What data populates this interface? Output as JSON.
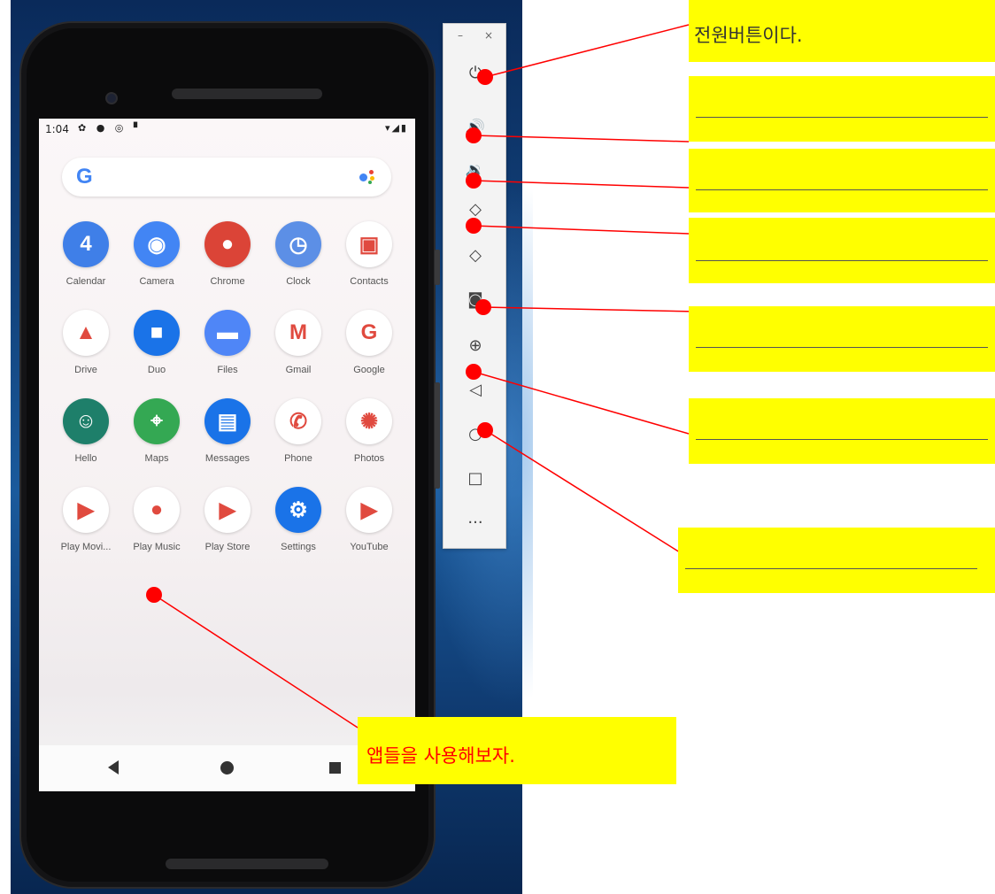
{
  "status_bar": {
    "time": "1:04",
    "left_icons": "✿ ● ◎ ▘",
    "right_icons": "▾◢▮"
  },
  "search": {
    "logo": "G"
  },
  "apps": [
    {
      "label": "Calendar",
      "glyph": "4",
      "bg": "#3f7fe8",
      "name": "calendar-app"
    },
    {
      "label": "Camera",
      "glyph": "◉",
      "bg": "#4285f4",
      "name": "camera-app"
    },
    {
      "label": "Chrome",
      "glyph": "●",
      "bg": "#db4437",
      "name": "chrome-app"
    },
    {
      "label": "Clock",
      "glyph": "◷",
      "bg": "#5c8fe6",
      "name": "clock-app"
    },
    {
      "label": "Contacts",
      "glyph": "▣",
      "bg": "#ffffff",
      "name": "contacts-app"
    },
    {
      "label": "Drive",
      "glyph": "▲",
      "bg": "#ffffff",
      "name": "drive-app"
    },
    {
      "label": "Duo",
      "glyph": "■",
      "bg": "#1a73e8",
      "name": "duo-app"
    },
    {
      "label": "Files",
      "glyph": "▬",
      "bg": "#4f86f7",
      "name": "files-app"
    },
    {
      "label": "Gmail",
      "glyph": "M",
      "bg": "#ffffff",
      "name": "gmail-app"
    },
    {
      "label": "Google",
      "glyph": "G",
      "bg": "#ffffff",
      "name": "google-app"
    },
    {
      "label": "Hello",
      "glyph": "☺",
      "bg": "#1e7f6a",
      "name": "hello-app"
    },
    {
      "label": "Maps",
      "glyph": "⌖",
      "bg": "#34a853",
      "name": "maps-app"
    },
    {
      "label": "Messages",
      "glyph": "▤",
      "bg": "#1a73e8",
      "name": "messages-app"
    },
    {
      "label": "Phone",
      "glyph": "✆",
      "bg": "#ffffff",
      "name": "phone-app"
    },
    {
      "label": "Photos",
      "glyph": "✺",
      "bg": "#ffffff",
      "name": "photos-app"
    },
    {
      "label": "Play Movi...",
      "glyph": "▶",
      "bg": "#ffffff",
      "name": "play-movies-app"
    },
    {
      "label": "Play Music",
      "glyph": "●",
      "bg": "#ffffff",
      "name": "play-music-app"
    },
    {
      "label": "Play Store",
      "glyph": "▶",
      "bg": "#ffffff",
      "name": "play-store-app"
    },
    {
      "label": "Settings",
      "glyph": "⚙",
      "bg": "#1a73e8",
      "name": "settings-app"
    },
    {
      "label": "YouTube",
      "glyph": "▶",
      "bg": "#ffffff",
      "name": "youtube-app"
    }
  ],
  "toolbar": {
    "minimize": "–",
    "close": "×",
    "buttons": [
      {
        "name": "power-button",
        "icon": "power-icon",
        "glyph": "⏻"
      },
      {
        "name": "volume-up-button",
        "icon": "volume-up-icon",
        "glyph": "🔊"
      },
      {
        "name": "volume-down-button",
        "icon": "volume-down-icon",
        "glyph": "🔉"
      },
      {
        "name": "rotate-left-button",
        "icon": "rotate-left-icon",
        "glyph": "◇"
      },
      {
        "name": "rotate-right-button",
        "icon": "rotate-right-icon",
        "glyph": "◇"
      },
      {
        "name": "screenshot-button",
        "icon": "camera-icon",
        "glyph": "◙"
      },
      {
        "name": "zoom-button",
        "icon": "zoom-icon",
        "glyph": "⊕"
      },
      {
        "name": "back-button",
        "icon": "back-icon",
        "glyph": "◁"
      },
      {
        "name": "home-button",
        "icon": "home-icon",
        "glyph": "○"
      },
      {
        "name": "overview-button",
        "icon": "overview-icon",
        "glyph": "□"
      },
      {
        "name": "more-button",
        "icon": "more-icon",
        "glyph": "···"
      }
    ]
  },
  "annotations": {
    "power": "전원버튼이다.",
    "apps": "앱들을 사용해보자."
  },
  "colors": {
    "highlight": "#ffff00",
    "marker": "#ff0000"
  }
}
